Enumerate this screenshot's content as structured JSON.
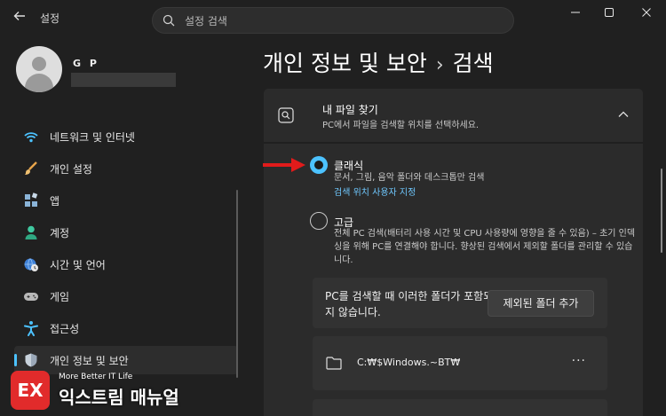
{
  "window": {
    "back_icon": "back-arrow-icon",
    "title": "설정",
    "controls": [
      "minimize-icon",
      "maximize-icon",
      "close-icon"
    ]
  },
  "search": {
    "placeholder": "설정 검색",
    "icon": "search-icon"
  },
  "user": {
    "name": "G P"
  },
  "sidebar": {
    "items": [
      {
        "label": "네트워크 및 인터넷",
        "icon": "wifi-icon"
      },
      {
        "label": "개인 설정",
        "icon": "brush-icon"
      },
      {
        "label": "앱",
        "icon": "apps-icon"
      },
      {
        "label": "계정",
        "icon": "account-icon"
      },
      {
        "label": "시간 및 언어",
        "icon": "globe-clock-icon"
      },
      {
        "label": "게임",
        "icon": "gamepad-icon"
      },
      {
        "label": "접근성",
        "icon": "accessibility-icon"
      },
      {
        "label": "개인 정보 및 보안",
        "icon": "shield-icon",
        "active": true
      }
    ]
  },
  "breadcrumb": {
    "parent": "개인 정보 및 보안",
    "separator": "›",
    "current": "검색"
  },
  "find_files": {
    "icon": "search-square-icon",
    "title": "내 파일 찾기",
    "subtitle": "PC에서 파일을 검색할 위치를 선택하세요.",
    "chevron": "chevron-up-icon",
    "options": [
      {
        "title": "클래식",
        "desc": "문서, 그림, 음악 폴더와 데스크톱만 검색",
        "link": "검색 위치 사용자 지정",
        "selected": true
      },
      {
        "title": "고급",
        "desc": "전체 PC 검색(배터리 사용 시간 및 CPU 사용량에 영향을 줄 수 있음) – 초기 인덱싱을 위해 PC를 연결해야 합니다. 향상된 검색에서 제외할 폴더를 관리할 수 있습니다.",
        "selected": false
      }
    ]
  },
  "excluded": {
    "text": "PC를 검색할 때 이러한 폴더가 포함되지 않습니다.",
    "button": "제외된 폴더 추가",
    "folders": [
      {
        "path": "C:₩$Windows.~BT₩",
        "more": "···"
      }
    ]
  },
  "watermark": {
    "logo": "EX",
    "tagline": "More Better IT Life",
    "name": "익스트림 매뉴얼"
  },
  "colors": {
    "accent": "#4cc2ff",
    "background": "#202020",
    "card": "#2b2b2b",
    "annotation": "#e11b1b"
  }
}
